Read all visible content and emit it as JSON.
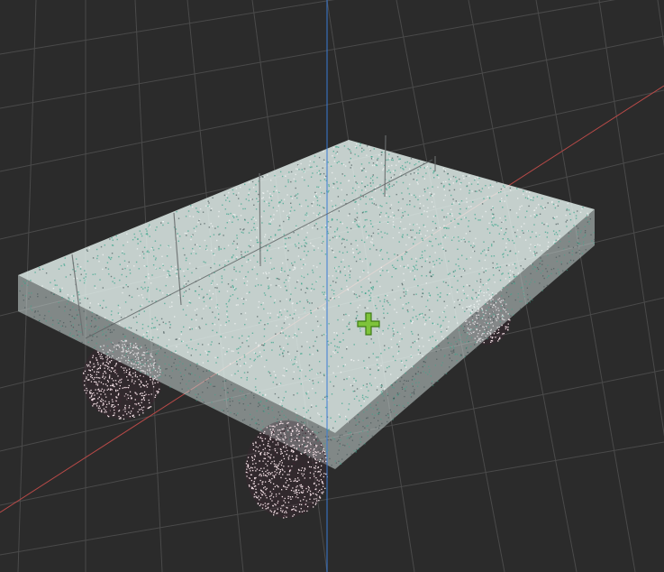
{
  "viewport": {
    "background_color": "#2b2b2b",
    "grid_color": "#4a4a4a",
    "x_axis_color": "#b84a48",
    "z_axis_color": "#3a7bd5"
  },
  "model": {
    "point_color_light": "#e6f4f0",
    "point_color_teal": "#3aa58c",
    "point_color_dark": "#37474a",
    "wheel_point_color": "#f4e1e6",
    "wheel_shadow_color": "#3b2630"
  },
  "gizmo": {
    "icon": "move-icon",
    "color": "#7ec33a",
    "outline_color": "#3e7a15"
  }
}
